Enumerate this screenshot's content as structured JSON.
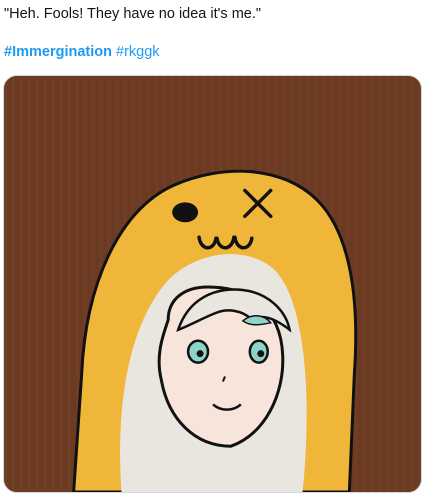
{
  "tweet": {
    "text": "\"Heh. Fools! They have no idea it's me.\"",
    "hashtags": [
      {
        "label": "#Immergination"
      },
      {
        "label": "#rkggk"
      }
    ]
  },
  "media": {
    "kind": "illustration",
    "colors": {
      "background": "#6b3a21",
      "hood": "#f0b63a",
      "hair": "#e9e6e0",
      "skin": "#f7e4da",
      "eyes": "#8fd3c8",
      "outline": "#111111"
    }
  }
}
